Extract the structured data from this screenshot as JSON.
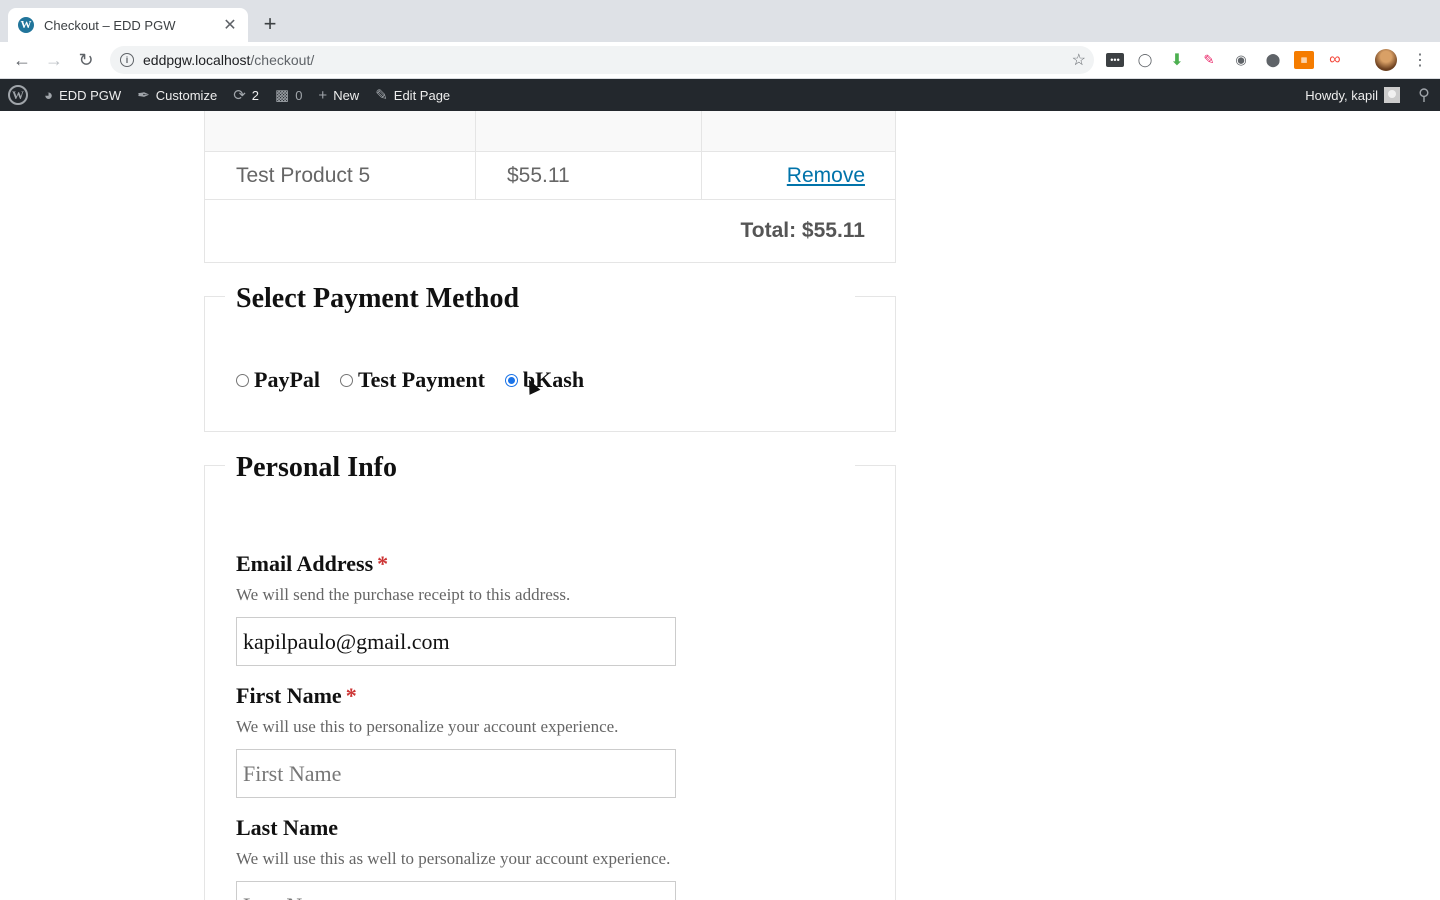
{
  "browser": {
    "tab_title": "Checkout – EDD PGW",
    "tab_close": "✕",
    "new_tab": "+",
    "url_host": "eddpgw.localhost",
    "url_path": "/checkout/",
    "favicon_glyph": "W"
  },
  "adminbar": {
    "site_name": "EDD PGW",
    "customize": "Customize",
    "updates_count": "2",
    "comments_count": "0",
    "new_label": "New",
    "edit_page": "Edit Page",
    "howdy": "Howdy, kapil"
  },
  "cart": {
    "items": [
      {
        "name": "Test Product 5",
        "price": "$55.11",
        "action": "Remove"
      }
    ],
    "total": "Total: $55.11"
  },
  "payment": {
    "legend": "Select Payment Method",
    "gateways": [
      {
        "label": "PayPal",
        "checked": false
      },
      {
        "label": "Test Payment",
        "checked": false
      },
      {
        "label": "bKash",
        "checked": true
      }
    ]
  },
  "personal": {
    "legend": "Personal Info",
    "email": {
      "label": "Email Address",
      "required": "*",
      "description": "We will send the purchase receipt to this address.",
      "value": "kapilpaulo@gmail.com"
    },
    "first_name": {
      "label": "First Name",
      "required": "*",
      "description": "We will use this to personalize your account experience.",
      "placeholder": "First Name"
    },
    "last_name": {
      "label": "Last Name",
      "description": "We will use this as well to personalize your account experience.",
      "placeholder": "Last Name"
    }
  },
  "colors": {
    "link": "#0073aa",
    "adminbar_bg": "#23282d",
    "radio_checked": "#1a73e8",
    "required": "#cc3333"
  }
}
